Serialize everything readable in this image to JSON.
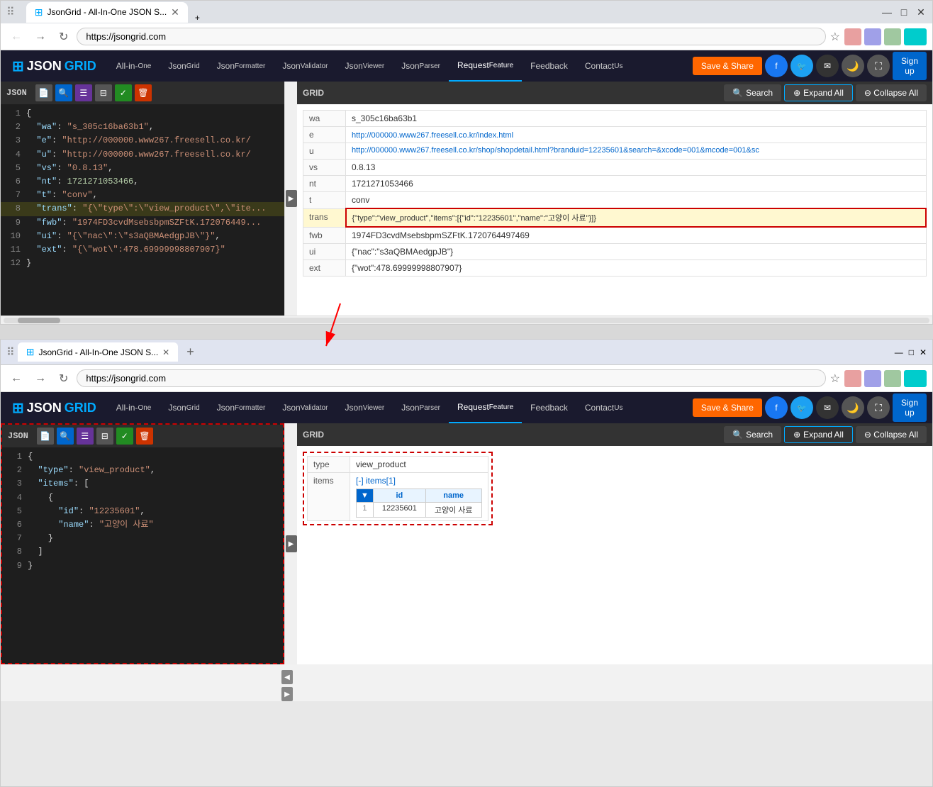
{
  "browser1": {
    "tab_title": "JsonGrid - All-In-One JSON S...",
    "tab_url": "https://jsongrid.com",
    "new_tab_label": "+",
    "nav": {
      "back": "←",
      "forward": "→",
      "refresh": "↻",
      "address": "https://jsongrid.com",
      "star": "☆"
    },
    "win_controls": {
      "minimize": "—",
      "maximize": "□",
      "close": "✕"
    }
  },
  "app": {
    "logo_icon": "⊞",
    "logo_text_json": "JSON",
    "logo_text_grid": "GRID",
    "nav_items": [
      {
        "id": "all-in-one",
        "label": "All-in-",
        "sublabel": "One"
      },
      {
        "id": "json-grid",
        "label": "Json",
        "sublabel": "Grid"
      },
      {
        "id": "json-formatter",
        "label": "Json",
        "sublabel": "Formatter"
      },
      {
        "id": "json-validator",
        "label": "Json",
        "sublabel": "Validator"
      },
      {
        "id": "json-viewer",
        "label": "Json",
        "sublabel": "Viewer"
      },
      {
        "id": "json-parser",
        "label": "Json",
        "sublabel": "Parser"
      },
      {
        "id": "request-feature",
        "label": "Request",
        "sublabel": "Feature",
        "active": true
      },
      {
        "id": "feedback",
        "label": "Feedback",
        "sublabel": ""
      },
      {
        "id": "contact-us",
        "label": "Contact",
        "sublabel": "Us"
      }
    ],
    "save_share_label": "Save & Share",
    "sign_up_label": "Sign up"
  },
  "panel1": {
    "json_label": "JSON",
    "grid_label": "GRID",
    "toolbar_btns": [
      "📄",
      "🔍",
      "≡",
      "⊟",
      "✓",
      "🗑"
    ],
    "search_label": "Search",
    "expand_all_label": "Expand All",
    "collapse_all_label": "Collapse All",
    "json_lines": [
      {
        "num": 1,
        "text": "{"
      },
      {
        "num": 2,
        "text": "  \"wa\": \"s_305c16ba63b1\","
      },
      {
        "num": 3,
        "text": "  \"e\": \"http://000000.www267.freesell.co.kr/..."
      },
      {
        "num": 4,
        "text": "  \"u\": \"http://000000.www267.freesell.co.kr/..."
      },
      {
        "num": 5,
        "text": "  \"vs\": \"0.8.13\","
      },
      {
        "num": 6,
        "text": "  \"nt\": 1721271053466,"
      },
      {
        "num": 7,
        "text": "  \"t\": \"conv\","
      },
      {
        "num": 8,
        "text": "  \"trans\": \"{\\\"type\\\":\\\"view_product\\\",\\\"ite...",
        "highlighted": true
      },
      {
        "num": 9,
        "text": "  \"fwb\": \"1974FD3cvdMsebsbpmSZFtK.172076449..."
      },
      {
        "num": 10,
        "text": "  \"ui\": \"{\\\"nac\\\":\\\"s3aQBMAedgpJB\\\"}\","
      },
      {
        "num": 11,
        "text": "  \"ext\": \"{\\\"wot\\\":478.69999998807907}\""
      },
      {
        "num": 12,
        "text": "}"
      }
    ],
    "grid_rows": [
      {
        "key": "wa",
        "value": "s_305c16ba63b1"
      },
      {
        "key": "e",
        "value": "http://000000.www267.freesell.co.kr/index.html"
      },
      {
        "key": "u",
        "value": "http://000000.www267.freesell.co.kr/shop/shopdetail.html?branduid=12235601&search=&xcode=001&mcode=001&sc"
      },
      {
        "key": "vs",
        "value": "0.8.13"
      },
      {
        "key": "nt",
        "value": "1721271053466"
      },
      {
        "key": "t",
        "value": "conv"
      },
      {
        "key": "trans",
        "value": "{\"type\":\"view_product\",\"items\":[{\"id\":\"12235601\",\"name\":\"고양이 사료\"}]}",
        "highlighted": true
      },
      {
        "key": "fwb",
        "value": "1974FD3cvdMsebsbpmSZFtK.1720764497469"
      },
      {
        "key": "ui",
        "value": "{\"nac\":\"s3aQBMAedgpJB\"}"
      },
      {
        "key": "ext",
        "value": "{\"wot\":478.69999998807907}"
      }
    ]
  },
  "panel2": {
    "json_label": "JSON",
    "grid_label": "GRID",
    "search_label": "Search",
    "expand_all_label": "Expand All",
    "collapse_all_label": "Collapse All",
    "json_lines": [
      {
        "num": 1,
        "text": "{"
      },
      {
        "num": 2,
        "text": "  \"type\": \"view_product\","
      },
      {
        "num": 3,
        "text": "  \"items\": ["
      },
      {
        "num": 4,
        "text": "    {"
      },
      {
        "num": 5,
        "text": "      \"id\": \"12235601\","
      },
      {
        "num": 6,
        "text": "      \"name\": \"고양이 사료\""
      },
      {
        "num": 7,
        "text": "    }"
      },
      {
        "num": 8,
        "text": "  ]"
      },
      {
        "num": 9,
        "text": "}"
      }
    ],
    "grid_rows": [
      {
        "key": "type",
        "value": "view_product"
      },
      {
        "key": "items",
        "value": "[-] items[1]",
        "is_items": true
      }
    ],
    "items_table": {
      "headers": [
        "id",
        "name"
      ],
      "rows": [
        {
          "num": 1,
          "id": "12235601",
          "name": "고양이 사료"
        }
      ]
    }
  },
  "icons": {
    "search": "🔍",
    "expand_circle": "⊕",
    "collapse_circle": "⊖",
    "filter": "▼",
    "arrow_right": "▶",
    "arrow_left": "◀",
    "new_doc": "📄",
    "list": "☰",
    "check": "✓",
    "trash": "🗑",
    "moon": "🌙",
    "fullscreen": "⛶",
    "share": "↗",
    "mail": "✉"
  },
  "browser2": {
    "tab_title": "JsonGrid - All-In-One JSON S...",
    "tab_url": "https://jsongrid.com",
    "win_controls": {
      "minimize": "—",
      "maximize": "□",
      "close": "✕"
    }
  }
}
